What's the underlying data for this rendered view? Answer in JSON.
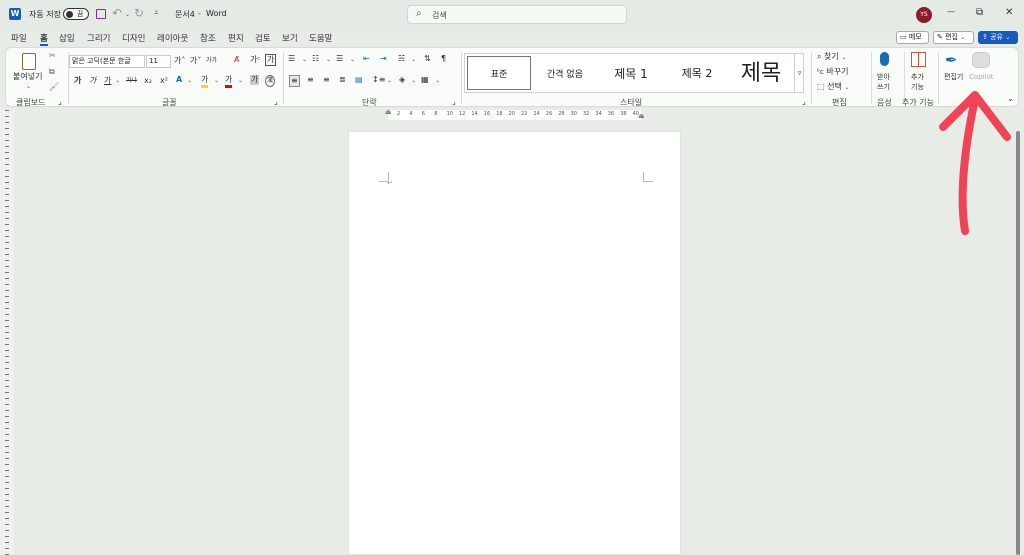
{
  "titlebar": {
    "autosave_label": "자동 저장",
    "autosave_state": "끔",
    "doc_title": "문서4",
    "app_separator": "-",
    "app_name": "Word",
    "search_placeholder": "검색",
    "user_initials": "YS",
    "minimize": "—",
    "restore": "⧉",
    "close": "✕"
  },
  "menu": {
    "tabs": [
      "파일",
      "홈",
      "삽입",
      "그리기",
      "디자인",
      "레이아웃",
      "참조",
      "편지",
      "검토",
      "보기",
      "도움말"
    ],
    "memo_label": "메모",
    "edit_label": "편집",
    "share_label": "공유"
  },
  "ribbon": {
    "clipboard": {
      "paste": "붙여넣기",
      "group": "클립보드"
    },
    "font": {
      "name": "맑은 고딕(본문 한글",
      "size": "11",
      "group": "글꼴",
      "bold": "가",
      "italic": "가",
      "underline": "가",
      "strike": "가나",
      "sub": "x₂",
      "sup": "x²",
      "grow": "가˄",
      "shrink": "가˅",
      "case": "가가",
      "clear": "가",
      "hanja": "漢",
      "color_a": "가",
      "highlight": "가"
    },
    "paragraph": {
      "group": "단락"
    },
    "styles": {
      "group": "스타일",
      "items": [
        "표준",
        "간격 없음",
        "제목 1",
        "제목 2",
        "제목"
      ]
    },
    "editing": {
      "find": "찾기",
      "replace": "바꾸기",
      "select": "선택",
      "group": "편집"
    },
    "voice": {
      "dictate": "받아\n쓰기",
      "group": "음성"
    },
    "addins": {
      "label": "추가\n기능",
      "group": "추가 기능"
    },
    "editor_label": "편집기",
    "copilot_label": "Copilot"
  },
  "ruler": {
    "ticks": [
      "2",
      "4",
      "6",
      "8",
      "10",
      "12",
      "14",
      "16",
      "18",
      "20",
      "22",
      "24",
      "26",
      "28",
      "30",
      "32",
      "34",
      "36",
      "38",
      "40"
    ]
  },
  "colors": {
    "accent": "#185abd",
    "annotation_arrow": "#ee4455",
    "avatar": "#8b1a2b"
  }
}
